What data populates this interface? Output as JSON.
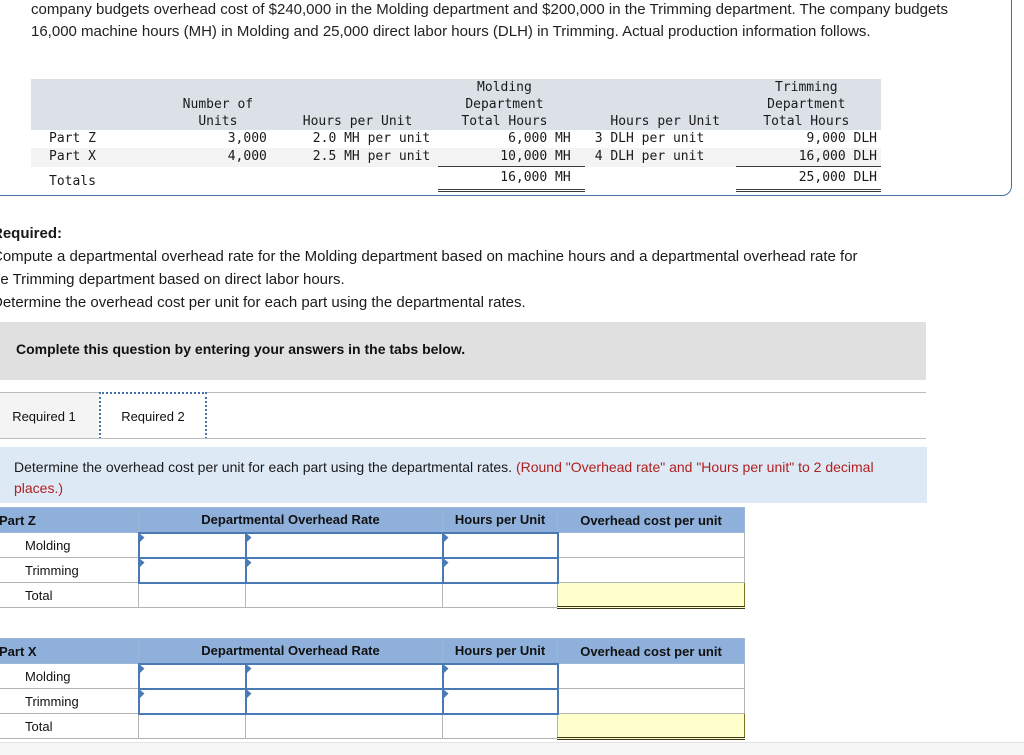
{
  "problem": {
    "paragraph": "company budgets overhead cost of $240,000 in the Molding department and $200,000 in the Trimming department. The company budgets 16,000 machine hours (MH) in Molding and 25,000 direct labor hours (DLH) in Trimming. Actual production information follows."
  },
  "data_table": {
    "group_headers": {
      "blank": "",
      "units_top": "Number of",
      "molding": "Molding Department",
      "trimming": "Trimming Department"
    },
    "sub_headers": {
      "blank": "",
      "units": "Units",
      "molding_hpu": "Hours per Unit",
      "molding_total": "Total Hours",
      "trimming_hpu": "Hours per Unit",
      "trimming_total": "Total Hours"
    },
    "rows": [
      {
        "label": "Part Z",
        "units": "3,000",
        "molding_hpu": "2.0 MH per unit",
        "molding_total": "6,000 MH",
        "trimming_hpu": "3 DLH per unit",
        "trimming_total": "9,000 DLH"
      },
      {
        "label": "Part X",
        "units": "4,000",
        "molding_hpu": "2.5 MH per unit",
        "molding_total": "10,000 MH",
        "trimming_hpu": "4 DLH per unit",
        "trimming_total": "16,000 DLH"
      },
      {
        "label": "Totals",
        "units": "",
        "molding_hpu": "",
        "molding_total": "16,000 MH",
        "trimming_hpu": "",
        "trimming_total": "25,000 DLH"
      }
    ]
  },
  "required": {
    "heading": "Required:",
    "item1_line1": "Compute a departmental overhead rate for the Molding department based on machine hours and a departmental overhead rate for",
    "item1_line2": "he Trimming department based on direct labor hours.",
    "item2": "Determine the overhead cost per unit for each part using the departmental rates."
  },
  "banner": {
    "text": "Complete this question by entering your answers in the tabs below."
  },
  "tabs": {
    "items": [
      {
        "label": "Required 1",
        "active": false
      },
      {
        "label": "Required 2",
        "active": true
      }
    ]
  },
  "instruction": {
    "main": "Determine the overhead cost per unit for each part using the departmental rates. ",
    "note": "(Round \"Overhead rate\" and \"Hours per unit\" to 2 decimal places.)"
  },
  "answer_tables": [
    {
      "part_label": "Part Z",
      "col_rate": "Departmental Overhead Rate",
      "col_hours": "Hours per Unit",
      "col_cost": "Overhead cost per unit",
      "rows": [
        {
          "label": "Molding",
          "rate_a": "",
          "rate_b": "",
          "hours": "",
          "cost": ""
        },
        {
          "label": "Trimming",
          "rate_a": "",
          "rate_b": "",
          "hours": "",
          "cost": ""
        },
        {
          "label": "Total",
          "rate_a": "",
          "rate_b": "",
          "hours": "",
          "cost": ""
        }
      ]
    },
    {
      "part_label": "Part X",
      "col_rate": "Departmental Overhead Rate",
      "col_hours": "Hours per Unit",
      "col_cost": "Overhead cost per unit",
      "rows": [
        {
          "label": "Molding",
          "rate_a": "",
          "rate_b": "",
          "hours": "",
          "cost": ""
        },
        {
          "label": "Trimming",
          "rate_a": "",
          "rate_b": "",
          "hours": "",
          "cost": ""
        },
        {
          "label": "Total",
          "rate_a": "",
          "rate_b": "",
          "hours": "",
          "cost": ""
        }
      ]
    }
  ],
  "colors": {
    "panel_border": "#4a6fa5",
    "header_blue": "#8eb0da",
    "instruction_blue": "#ddeaf6",
    "banner_gray": "#e0e0e0",
    "input_border": "#4a7ab5",
    "total_yellow": "#ffffcc",
    "note_red": "#b02020"
  }
}
